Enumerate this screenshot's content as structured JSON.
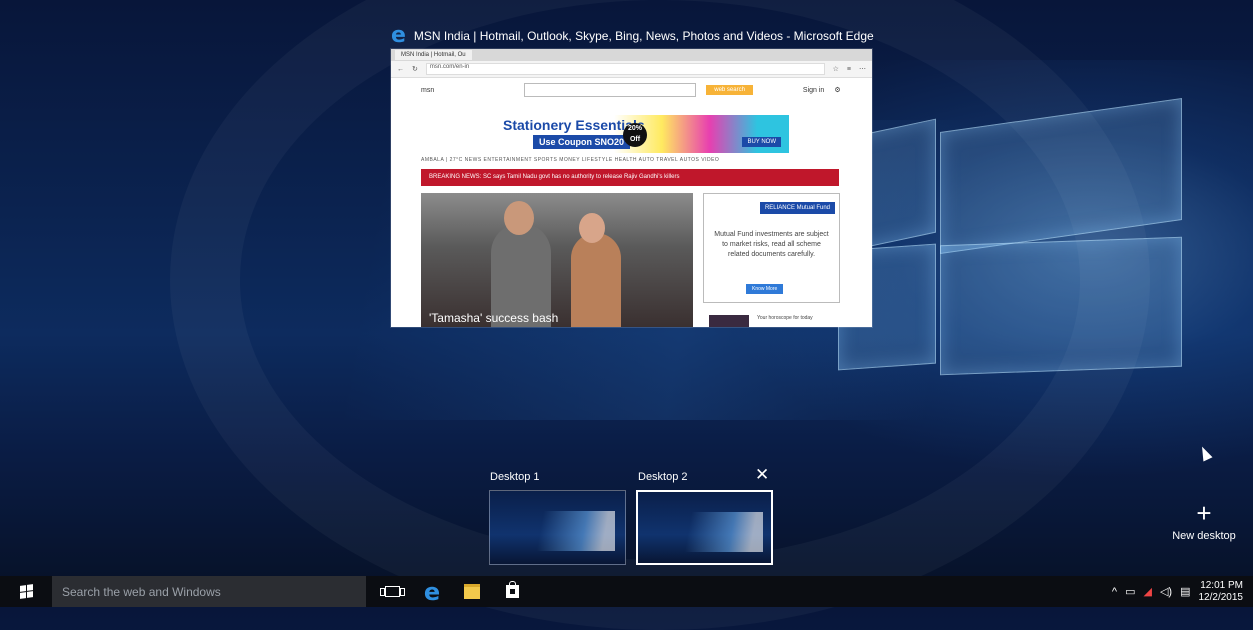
{
  "window": {
    "title": "MSN India | Hotmail, Outlook, Skype, Bing, News, Photos and Videos - Microsoft Edge",
    "tab_label": "MSN India | Hotmail, Ou",
    "url": "msn.com/en-in",
    "msn_label": "msn",
    "search_button": "web search",
    "sign_in": "Sign in",
    "ad_title": "Stationery Essentials",
    "ad_coupon": "Use Coupon SNO20",
    "ad_discount": "20% Off",
    "ad_buy": "BUY NOW",
    "nav_links": "AMBALA | 27°C    NEWS    ENTERTAINMENT    SPORTS    MONEY    LIFESTYLE    HEALTH    AUTO    TRAVEL    AUTOS    VIDEO",
    "breaking": "BREAKING NEWS: SC says Tamil Nadu govt has no authority to release Rajiv Gandhi's killers",
    "photo_caption": "'Tamasha' success bash",
    "mf_logo": "RELIANCE Mutual Fund",
    "mf_text": "Mutual Fund investments are subject to market risks, read all scheme related documents carefully.",
    "mf_button": "Know More",
    "side_story": "Your horoscope for today"
  },
  "desktops": {
    "items": [
      {
        "label": "Desktop 1"
      },
      {
        "label": "Desktop 2"
      }
    ],
    "close_glyph": "✕",
    "new_glyph": "+",
    "new_label": "New desktop"
  },
  "taskbar": {
    "search_placeholder": "Search the web and Windows",
    "time": "12:01 PM",
    "date": "12/2/2015",
    "tray_chevron": "^"
  },
  "colors": {
    "accent": "#2f8fe0",
    "taskbar": "#0b0d12",
    "breaking": "#c0172b"
  }
}
